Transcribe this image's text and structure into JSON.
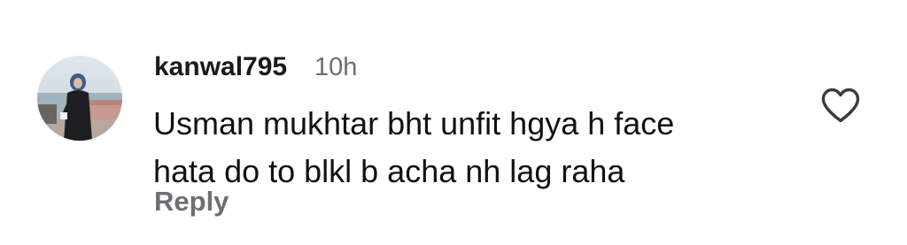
{
  "comment": {
    "username": "kanwal795",
    "timestamp": "10h",
    "text_lines": [
      "Usman mukhtar bht unfit hgya h face",
      "hata do to blkl b acha nh lag raha"
    ],
    "reply_label": "Reply",
    "avatar_icon": "user-avatar-photo",
    "like_icon": "heart-outline-icon"
  },
  "colors": {
    "username": "#1a1a1a",
    "secondary_text": "#6e6e73",
    "body_text": "#111111",
    "heart_stroke": "#3c3c3c"
  }
}
